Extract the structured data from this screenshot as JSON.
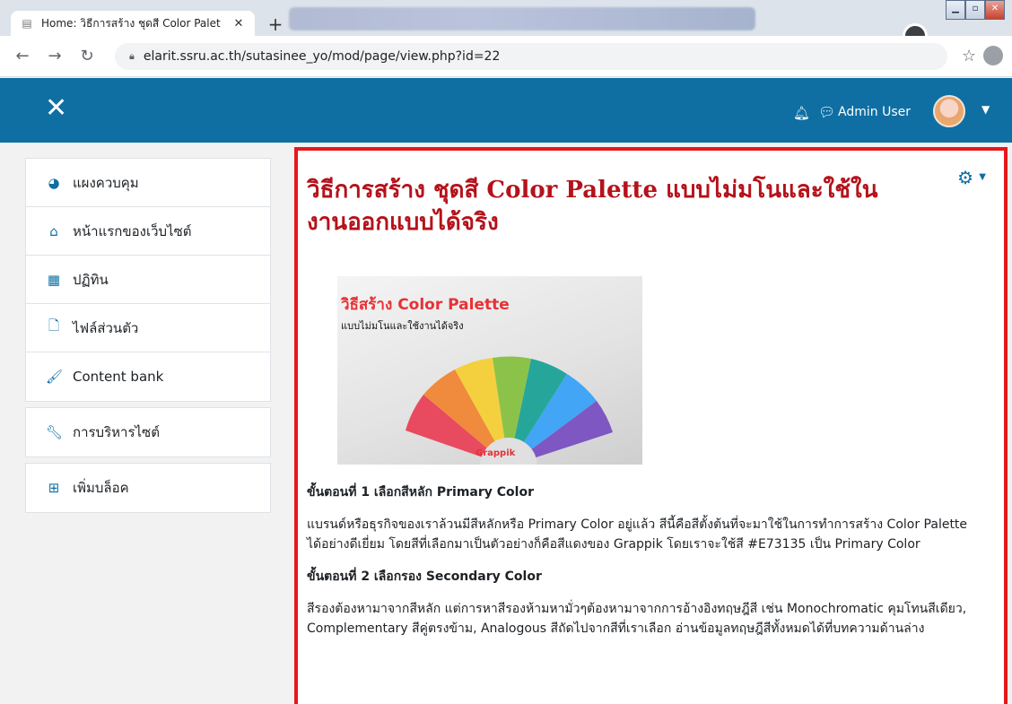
{
  "browser": {
    "tab_title": "Home: วิธีการสร้าง ชุดสี Color Palet",
    "tab_close": "✕",
    "new_tab": "+",
    "url": "elarit.ssru.ac.th/sutasinee_yo/mod/page/view.php?id=22"
  },
  "navbar": {
    "user_name": "Admin User"
  },
  "sidebar": {
    "groups": [
      [
        {
          "label": "แผงควบคุม",
          "icon": "dashboard-icon"
        },
        {
          "label": "หน้าแรกของเว็บไซต์",
          "icon": "home-icon"
        },
        {
          "label": "ปฏิทิน",
          "icon": "calendar-icon"
        },
        {
          "label": "ไฟล์ส่วนตัว",
          "icon": "file-icon"
        },
        {
          "label": "Content bank",
          "icon": "paintbrush-icon"
        }
      ],
      [
        {
          "label": "การบริหารไซต์",
          "icon": "wrench-icon"
        }
      ],
      [
        {
          "label": "เพิ่มบล็อค",
          "icon": "plus-square-icon"
        }
      ]
    ]
  },
  "page": {
    "title": "วิธีการสร้าง ชุดสี Color Palette แบบไม่มโนและใช้ในงานออกแบบได้จริง",
    "hero": {
      "title": "วิธีสร้าง Color Palette",
      "subtitle": "แบบไม่มโนและใช้งานได้จริง",
      "brand": "Grappik"
    },
    "step1_heading": "ขั้นตอนที่ 1 เลือกสีหลัก Primary Color",
    "step1_body": "แบรนด์หรือธุรกิจของเราล้วนมีสีหลักหรือ Primary Color อยู่แล้ว สีนี้คือสีตั้งต้นที่จะมาใช้ในการทำการสร้าง Color Palette ได้อย่างดีเยี่ยม โดยสีที่เลือกมาเป็นตัวอย่างก็คือสีแดงของ Grappik โดยเราจะใช้สี #E73135 เป็น Primary Color",
    "step2_heading": "ขั้นตอนที่ 2 เลือกรอง Secondary Color",
    "step2_body": "สีรองต้องหามาจากสีหลัก แต่การหาสีรองห้ามหามั่วๆต้องหามาจากการอ้างอิงทฤษฎีสี เช่น Monochromatic คุมโทนสีเดียว, Complementary สีคู่ตรงข้าม, Analogous สีถัดไปจากสีที่เราเลือก อ่านข้อมูลทฤษฎีสีทั้งหมดได้ที่บทความด้านล่าง"
  },
  "colors": {
    "navbar": "#0f6fa3",
    "title_red": "#b5121b",
    "highlight_border": "#e5181b",
    "brand_red": "#E73135"
  }
}
